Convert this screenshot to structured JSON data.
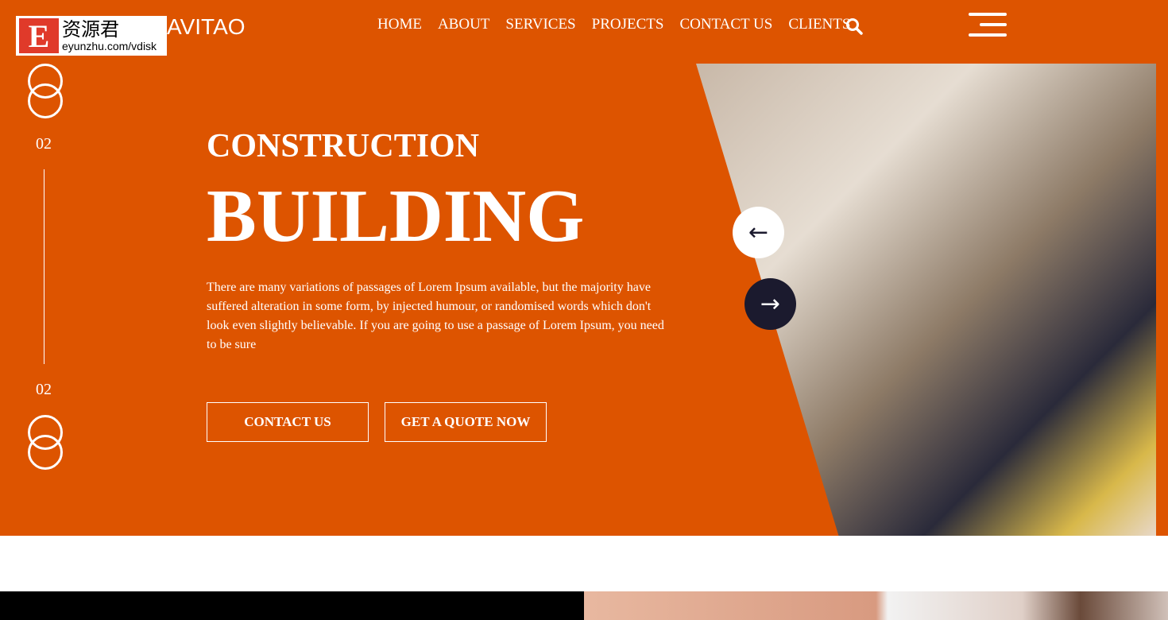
{
  "watermark": {
    "cn": "资源君",
    "url": "eyunzhu.com/vdisk",
    "letter": "E"
  },
  "brand": "AVITAO",
  "nav": [
    "HOME",
    "ABOUT",
    "SERVICES",
    "PROJECTS",
    "CONTACT US",
    "CLIENTS"
  ],
  "slider": {
    "current": "02",
    "total": "02"
  },
  "hero": {
    "subtitle": "CONSTRUCTION",
    "title": "BUILDING",
    "description": "There are many variations of passages of Lorem Ipsum available, but the majority have suffered alteration in some form, by injected humour, or randomised words which don't look even slightly believable. If you are going to use a passage of Lorem Ipsum, you need to be sure",
    "contact_label": "CONTACT US",
    "quote_label": "GET A QUOTE NOW"
  },
  "arrows": {
    "prev": "←",
    "next": "→"
  },
  "colors": {
    "accent": "#dd5400",
    "dark": "#1b1a2e"
  }
}
